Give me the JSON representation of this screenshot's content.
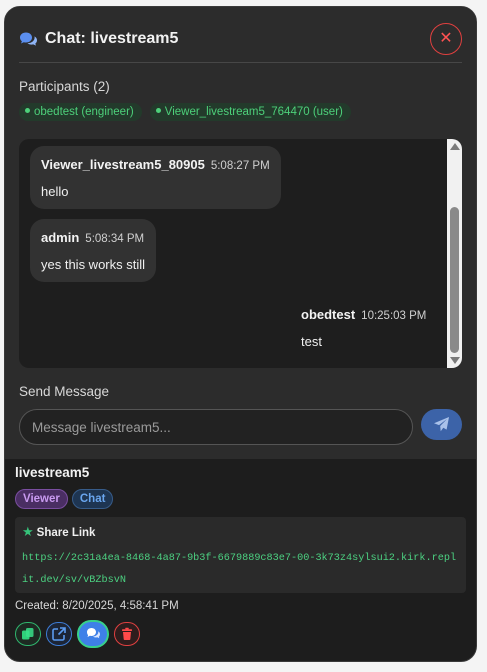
{
  "header": {
    "title": "Chat: livestream5",
    "close_label": "✕"
  },
  "participants": {
    "label": "Participants (2)",
    "items": [
      {
        "label": "obedtest (engineer)"
      },
      {
        "label": "Viewer_livestream5_764470 (user)"
      }
    ]
  },
  "messages": [
    {
      "author": "Viewer_livestream5_80905",
      "time": "5:08:27 PM",
      "text": "hello"
    },
    {
      "author": "admin",
      "time": "5:08:34 PM",
      "text": "yes this works still"
    },
    {
      "author": "obedtest",
      "time": "10:25:03 PM",
      "text": "test"
    }
  ],
  "send": {
    "label": "Send Message",
    "placeholder": "Message livestream5..."
  },
  "card": {
    "title": "livestream5",
    "badges": {
      "viewer": "Viewer",
      "chat": "Chat"
    },
    "share_title": "Share Link",
    "share_link": "https://2c31a4ea-8468-4a87-9b3f-6679889c83e7-00-3k73z4sylsui2.kirk.replit.dev/sv/vBZbsvN",
    "created": "Created: 8/20/2025, 4:58:41 PM"
  },
  "colors": {
    "accent_blue": "#3e80e8",
    "participant_green": "#4dd07a",
    "close_red": "#e0403f",
    "viewer_purple": "#c99af0"
  },
  "icons": [
    "chat-bubbles-icon",
    "close-icon",
    "send-icon",
    "star-icon",
    "copy-icon",
    "external-link-icon",
    "chat-icon",
    "trash-icon"
  ]
}
